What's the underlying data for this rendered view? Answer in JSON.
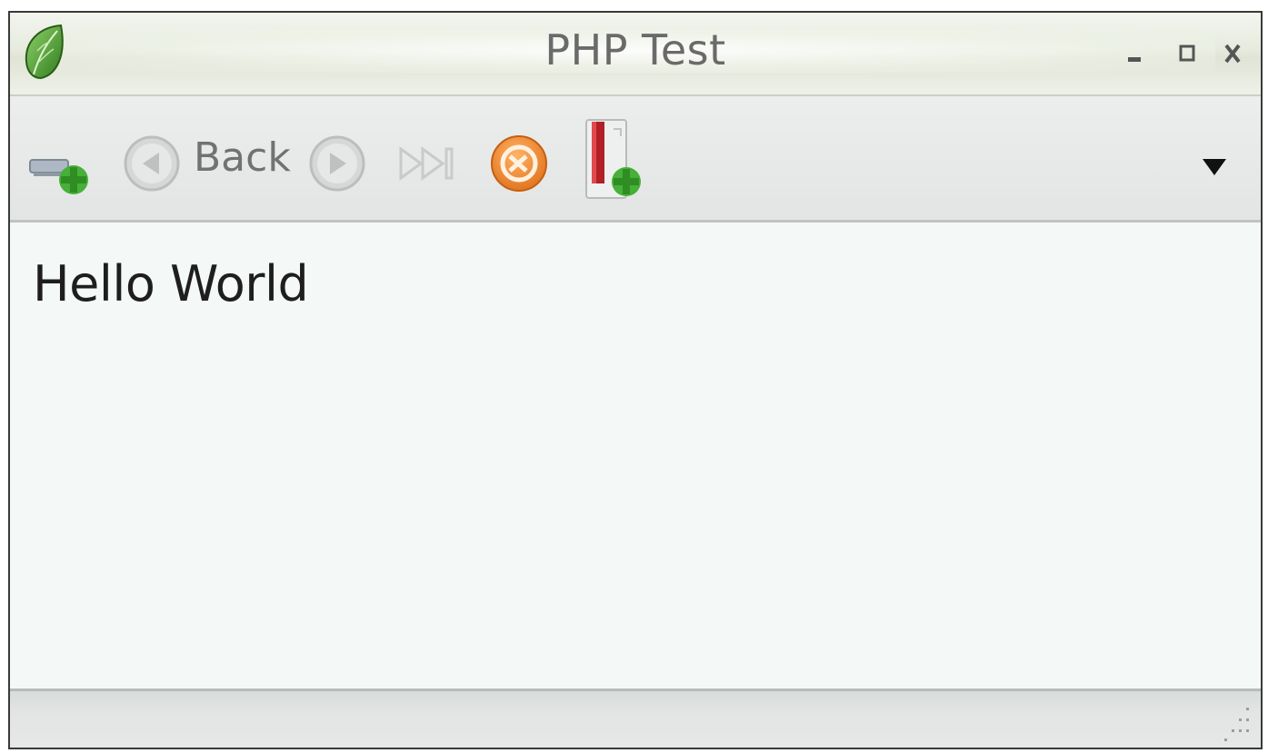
{
  "window": {
    "title": "PHP Test"
  },
  "titlebar": {
    "app_icon": "leaf-icon",
    "minimize_icon": "minimize-icon",
    "maximize_icon": "maximize-icon",
    "close_icon": "close-icon"
  },
  "toolbar": {
    "add_host_icon": "computer-add-icon",
    "back_icon": "back-arrow-icon",
    "back_label": "Back",
    "forward_icon": "forward-arrow-icon",
    "skip_icon": "skip-forward-icon",
    "stop_icon": "stop-icon",
    "install_icon": "package-add-icon",
    "overflow_icon": "chevron-down-icon"
  },
  "content": {
    "text": "Hello World"
  },
  "statusbar": {
    "grip_icon": "resize-grip-icon"
  },
  "colors": {
    "titlebar": "#e6ebde",
    "toolbar": "#e6e8e7",
    "content_background": "#f4f8f6",
    "accent_orange": "#ef8a2e",
    "accent_green": "#3ea93a"
  }
}
